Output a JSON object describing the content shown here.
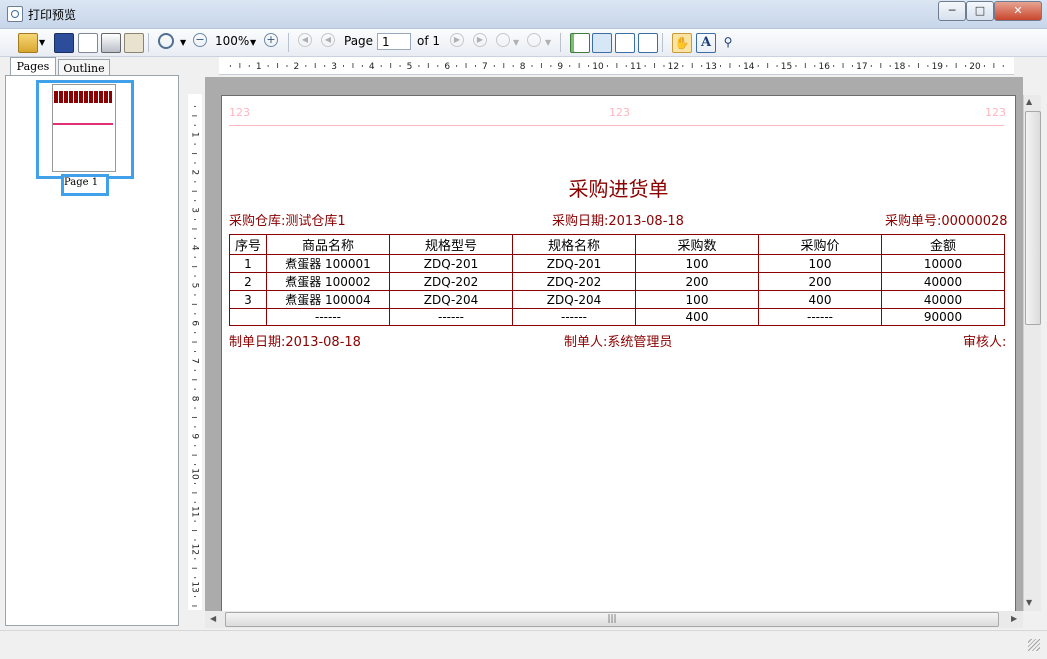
{
  "window": {
    "title": "打印预览"
  },
  "toolbar": {
    "zoom": "100%",
    "page_label": "Page",
    "page_value": "1",
    "of_label": "of 1"
  },
  "left_panel": {
    "tabs": [
      "Pages",
      "Outline"
    ],
    "thumb_label": "Page 1"
  },
  "ruler": {
    "h_marks": [
      "1",
      "2",
      "3",
      "4",
      "5",
      "6",
      "7",
      "8",
      "9",
      "10",
      "11",
      "12",
      "13",
      "14",
      "15",
      "16",
      "17",
      "18",
      "19",
      "20"
    ],
    "v_marks": [
      "1",
      "2",
      "3",
      "4",
      "5",
      "6",
      "7",
      "8",
      "9",
      "10",
      "11",
      "12",
      "13"
    ]
  },
  "report": {
    "header_marks": [
      "123",
      "123",
      "123"
    ],
    "title": "采购进货单",
    "warehouse": "采购仓库:测试仓库1",
    "date": "采购日期:2013-08-18",
    "order_no": "采购单号:00000028",
    "columns": [
      "序号",
      "商品名称",
      "规格型号",
      "规格名称",
      "采购数",
      "采购价",
      "金额"
    ],
    "rows": [
      [
        "1",
        "煮蛋器 100001",
        "ZDQ-201",
        "ZDQ-201",
        "100",
        "100",
        "10000"
      ],
      [
        "2",
        "煮蛋器 100002",
        "ZDQ-202",
        "ZDQ-202",
        "200",
        "200",
        "40000"
      ],
      [
        "3",
        "煮蛋器 100004",
        "ZDQ-204",
        "ZDQ-204",
        "100",
        "400",
        "40000"
      ],
      [
        "",
        "------",
        "------",
        "------",
        "400",
        "------",
        "90000"
      ]
    ],
    "made_date": "制单日期:2013-08-18",
    "maker": "制单人:系统管理员",
    "reviewer": "审核人:"
  }
}
